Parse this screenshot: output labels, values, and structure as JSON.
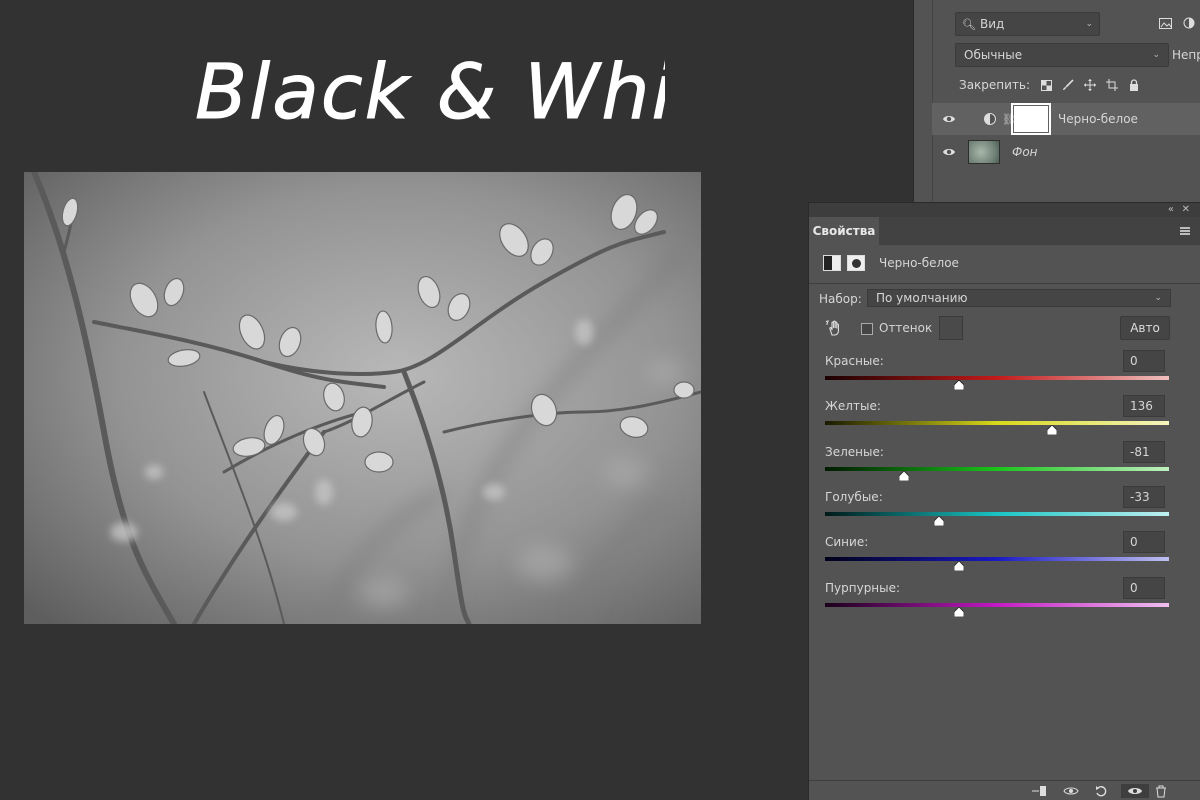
{
  "headline": {
    "text": "Black & White"
  },
  "layers_panel": {
    "filter": {
      "label": "Вид"
    },
    "blend_mode": {
      "value": "Обычные"
    },
    "opacity_label": "Непрозр",
    "lock_label": "Закрепить:",
    "layers": [
      {
        "name": "Черно-белое",
        "type": "adjustment",
        "selected": true
      },
      {
        "name": "Фон",
        "type": "background",
        "selected": false
      }
    ]
  },
  "properties_panel": {
    "tab_label": "Свойства",
    "title": "Черно-белое",
    "preset_label": "Набор:",
    "preset_value": "По умолчанию",
    "tint_label": "Оттенок",
    "auto_label": "Авто",
    "sliders": [
      {
        "label": "Красные:",
        "value": "0",
        "level": 0.39,
        "gradient": [
          "#1a0000",
          "#c41a1a",
          "#f0c0c0"
        ]
      },
      {
        "label": "Желтые:",
        "value": "136",
        "level": 0.66,
        "gradient": [
          "#1a1a00",
          "#d8d81a",
          "#f4f4c0"
        ]
      },
      {
        "label": "Зеленые:",
        "value": "-81",
        "level": 0.23,
        "gradient": [
          "#001a00",
          "#1ac41a",
          "#c0f0c0"
        ]
      },
      {
        "label": "Голубые:",
        "value": "-33",
        "level": 0.33,
        "gradient": [
          "#001a1a",
          "#1ac4c4",
          "#c0f0f0"
        ]
      },
      {
        "label": "Синие:",
        "value": "0",
        "level": 0.39,
        "gradient": [
          "#00001a",
          "#1a1ac4",
          "#c0c0f0"
        ]
      },
      {
        "label": "Пурпурные:",
        "value": "0",
        "level": 0.39,
        "gradient": [
          "#1a001a",
          "#c41ac4",
          "#f0c0f0"
        ]
      }
    ]
  },
  "icons": {
    "filter": "search-icon",
    "eye": "eye-icon",
    "hand": "targeted-adjustment-hand-icon"
  }
}
